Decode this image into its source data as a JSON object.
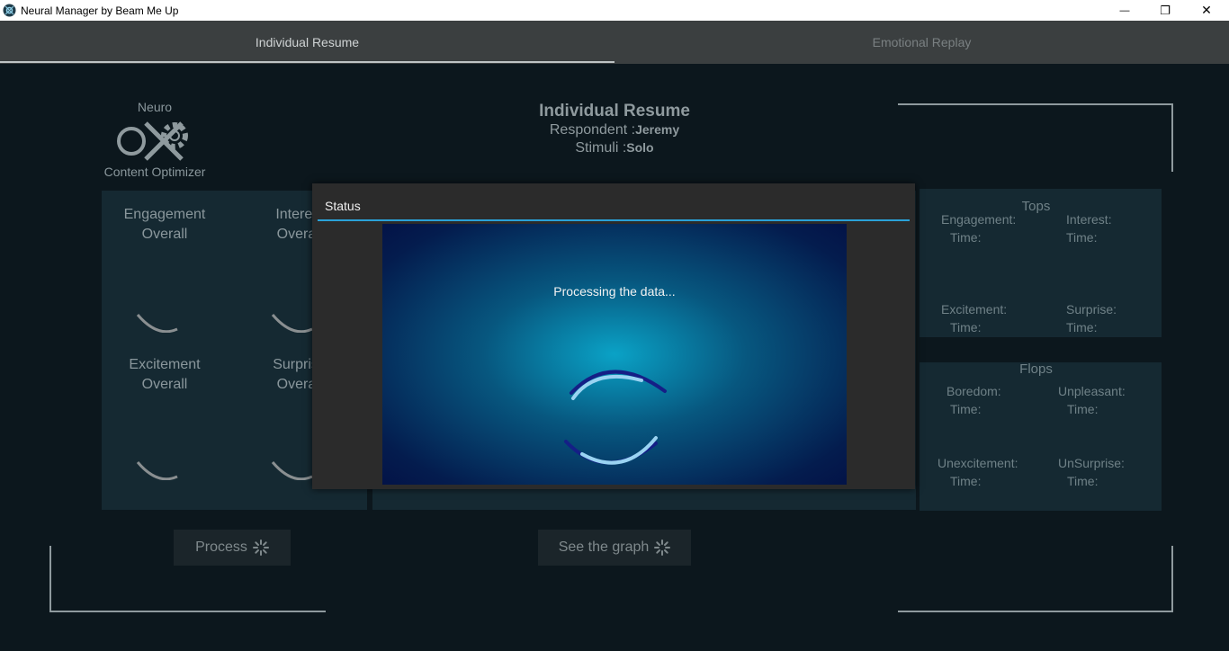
{
  "window": {
    "title": "Neural Manager by Beam Me Up",
    "minimize_glyph": "—",
    "maximize_glyph": "❐",
    "close_glyph": "✕"
  },
  "tabs": [
    {
      "label": "Individual Resume",
      "active": true
    },
    {
      "label": "Emotional Replay",
      "active": false
    }
  ],
  "logo": {
    "line1": "Neuro",
    "line2": "Content Optimizer"
  },
  "header": {
    "title": "Individual Resume",
    "respondent_label": "Respondent :",
    "respondent_value": "Jeremy",
    "stimuli_label": "Stimuli :",
    "stimuli_value": "Solo"
  },
  "metrics": [
    {
      "name": "Engagement",
      "sub": "Overall"
    },
    {
      "name": "Interest",
      "sub": "Overall"
    },
    {
      "name": "Excitement",
      "sub": "Overall"
    },
    {
      "name": "Surprise",
      "sub": "Overall"
    }
  ],
  "tops": {
    "title": "Tops",
    "items": [
      {
        "label": "Engagement:",
        "time": "Time:"
      },
      {
        "label": "Interest:",
        "time": "Time:"
      },
      {
        "label": "Excitement:",
        "time": "Time:"
      },
      {
        "label": "Surprise:",
        "time": "Time:"
      }
    ]
  },
  "flops": {
    "title": "Flops",
    "items": [
      {
        "label": "Boredom:",
        "time": "Time:"
      },
      {
        "label": "Unpleasant:",
        "time": "Time:"
      },
      {
        "label": "Unexcitement:",
        "time": "Time:"
      },
      {
        "label": "UnSurprise:",
        "time": "Time:"
      }
    ]
  },
  "buttons": {
    "process": "Process",
    "see_graph": "See the graph"
  },
  "modal": {
    "title": "Status",
    "message": "Processing the data..."
  },
  "colors": {
    "accent": "#2aa1d8",
    "panel": "#152932",
    "background": "#0c171d"
  }
}
